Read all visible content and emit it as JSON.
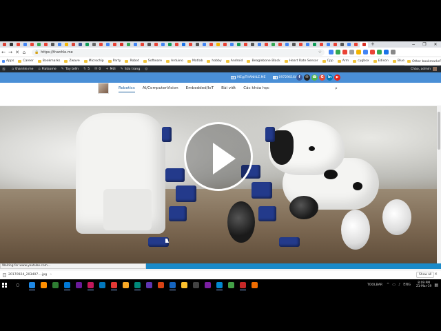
{
  "browser": {
    "tab_colors": [
      "#db4437",
      "#333333",
      "#ea4335",
      "#4285f4",
      "#ea4335",
      "#34a853",
      "#ea4335",
      "#555555",
      "#4285f4",
      "#f4b400",
      "#db4437",
      "#3b5998",
      "#0f9d58",
      "#666666",
      "#ea4335",
      "#4285f4",
      "#ea4335",
      "#d93025",
      "#34a853",
      "#4285f4",
      "#ea4335",
      "#555555",
      "#ea4335",
      "#4285f4",
      "#0f9d58",
      "#ea4335",
      "#1a73e8",
      "#ea4335",
      "#555555",
      "#4285f4",
      "#ea4335",
      "#f4b400",
      "#ea4335",
      "#4285f4",
      "#0f9d58",
      "#ea4335",
      "#555555",
      "#4285f4",
      "#ea4335",
      "#34a853",
      "#ea4335",
      "#4285f4",
      "#555555",
      "#ea4335",
      "#4285f4",
      "#0f9d58",
      "#ea4335",
      "#4285f4",
      "#ea4335",
      "#555555",
      "#4285f4",
      "#ea4335",
      "#d93025"
    ],
    "new_tab_icon": "plus-icon",
    "window_controls": [
      "−",
      "❐",
      "✕"
    ],
    "url": "https://thanhle.me",
    "extension_colors": [
      "#4285f4",
      "#34a853",
      "#ea4335",
      "#9e9e9e",
      "#f4b400",
      "#4285f4",
      "#ea4335",
      "#34a853",
      "#1a73e8",
      "#888888"
    ]
  },
  "bookmarks": {
    "items": [
      "Apps",
      "Career",
      "Bookmarks",
      "Zwave",
      "Microchip",
      "Party",
      "Robot",
      "Software",
      "Arduino",
      "Matlab",
      "hobby",
      "Android",
      "Beaglebone Black",
      "Heart Rate Sensor",
      "Cpp",
      "Arm",
      "cygbox",
      "Edison",
      "Bluetooth",
      "WiFi",
      "Notices"
    ],
    "other_label": "Other bookmarks"
  },
  "adminbar": {
    "items": [
      {
        "icon": "wordpress-icon",
        "label": ""
      },
      {
        "icon": "home-icon",
        "label": "thanhle.me"
      },
      {
        "icon": "home-icon",
        "label": "Flatsome"
      },
      {
        "icon": "brush-icon",
        "label": "Tùy biến"
      },
      {
        "icon": "refresh-icon",
        "label": "5"
      },
      {
        "icon": "comment-icon",
        "label": "0"
      },
      {
        "icon": "plus-icon",
        "label": "Mới"
      },
      {
        "icon": "edit-icon",
        "label": "Sửa trang"
      },
      {
        "icon": "settings-icon",
        "label": ""
      }
    ],
    "greeting": "Chào, admin"
  },
  "topbar": {
    "email": "ME@THANHLE.ME",
    "phone": "0972961646",
    "social": [
      {
        "name": "facebook",
        "glyph": "f",
        "color": "#3b5998"
      },
      {
        "name": "email",
        "glyph": "✉",
        "color": "#222222"
      },
      {
        "name": "phone",
        "glyph": "☎",
        "color": "#51b849"
      },
      {
        "name": "google-plus",
        "glyph": "G",
        "color": "#dd4b39"
      },
      {
        "name": "linkedin",
        "glyph": "in",
        "color": "#0077b5"
      },
      {
        "name": "youtube",
        "glyph": "▶",
        "color": "#e62117"
      }
    ],
    "accent_color": "#4a8fd6"
  },
  "nav": {
    "items": [
      "Robotics",
      "AI/ComputerVision",
      "Embedded/IoT",
      "Bài viết",
      "Các khóa học"
    ],
    "active_index": 0
  },
  "status_bar": {
    "text": "Waiting for www.youtube.com..."
  },
  "download_bar": {
    "file": "20170924_203407....jpg",
    "show_all": "Show all"
  },
  "taskbar": {
    "icon_colors": [
      "#1e88e5",
      "#ff8f00",
      "#2e7d32",
      "#0078d7",
      "#6a1b9a",
      "#c2185b",
      "#0277bd",
      "#e53935",
      "#f9a825",
      "#00897b",
      "#5e35b1",
      "#d84315",
      "#1565c0",
      "#fbc02d",
      "#424242",
      "#7b1fa2",
      "#0288d1",
      "#43a047",
      "#c62828",
      "#ef6c00"
    ],
    "toolbar_label": "TOOLBAR",
    "lang": "ENG",
    "time": "8:09 PM",
    "date": "21-Mar-19"
  }
}
